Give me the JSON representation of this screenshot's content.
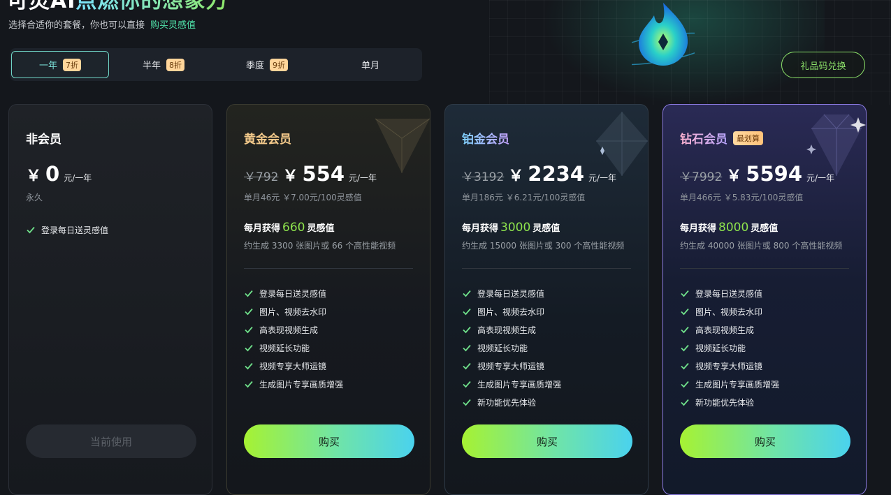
{
  "hero": {
    "title_plain": "可灵AI",
    "title_grad": "点燃你的想象力",
    "subtitle": "选择合适你的套餐，你也可以直接",
    "subtitle_link": "购买灵感值"
  },
  "tabs": [
    {
      "label": "一年",
      "badge": "7折",
      "active": true
    },
    {
      "label": "半年",
      "badge": "8折",
      "active": false
    },
    {
      "label": "季度",
      "badge": "9折",
      "active": false
    },
    {
      "label": "单月",
      "badge": "",
      "active": false
    }
  ],
  "gift_button": "礼品码兑换",
  "colors": {
    "accent_green": "#8ee44d",
    "accent_cyan": "#4ad2ee",
    "tab_active": "#6fd4c6",
    "diamond_border": "#8a7ae0"
  },
  "plans": {
    "free": {
      "title": "非会员",
      "yen": "￥",
      "price": "0",
      "unit": "元/一年",
      "sub": "永久",
      "features": [
        "登录每日送灵感值"
      ],
      "button": "当前使用"
    },
    "gold": {
      "title": "黄金会员",
      "old_price": "￥792",
      "yen": "￥",
      "price": "554",
      "unit": "元/一年",
      "sub": "单月46元 ￥7.00元/100灵感值",
      "monthly_prefix": "每月获得",
      "monthly_num": "660",
      "monthly_suffix": "灵感值",
      "monthly_sub": "约生成 3300 张图片或 66 个高性能视频",
      "features": [
        "登录每日送灵感值",
        "图片、视频去水印",
        "高表现视频生成",
        "视频延长功能",
        "视频专享大师运镜",
        "生成图片专享画质增强"
      ],
      "button": "购买"
    },
    "plat": {
      "title": "铂金会员",
      "old_price": "￥3192",
      "yen": "￥",
      "price": "2234",
      "unit": "元/一年",
      "sub": "单月186元 ￥6.21元/100灵感值",
      "monthly_prefix": "每月获得",
      "monthly_num": "3000",
      "monthly_suffix": "灵感值",
      "monthly_sub": "约生成 15000 张图片或 300 个高性能视频",
      "features": [
        "登录每日送灵感值",
        "图片、视频去水印",
        "高表现视频生成",
        "视频延长功能",
        "视频专享大师运镜",
        "生成图片专享画质增强",
        "新功能优先体验"
      ],
      "button": "购买"
    },
    "diam": {
      "title": "钻石会员",
      "badge": "最划算",
      "old_price": "￥7992",
      "yen": "￥",
      "price": "5594",
      "unit": "元/一年",
      "sub": "单月466元 ￥5.83元/100灵感值",
      "monthly_prefix": "每月获得",
      "monthly_num": "8000",
      "monthly_suffix": "灵感值",
      "monthly_sub": "约生成 40000 张图片或 800 个高性能视频",
      "features": [
        "登录每日送灵感值",
        "图片、视频去水印",
        "高表现视频生成",
        "视频延长功能",
        "视频专享大师运镜",
        "生成图片专享画质增强",
        "新功能优先体验"
      ],
      "button": "购买"
    }
  }
}
